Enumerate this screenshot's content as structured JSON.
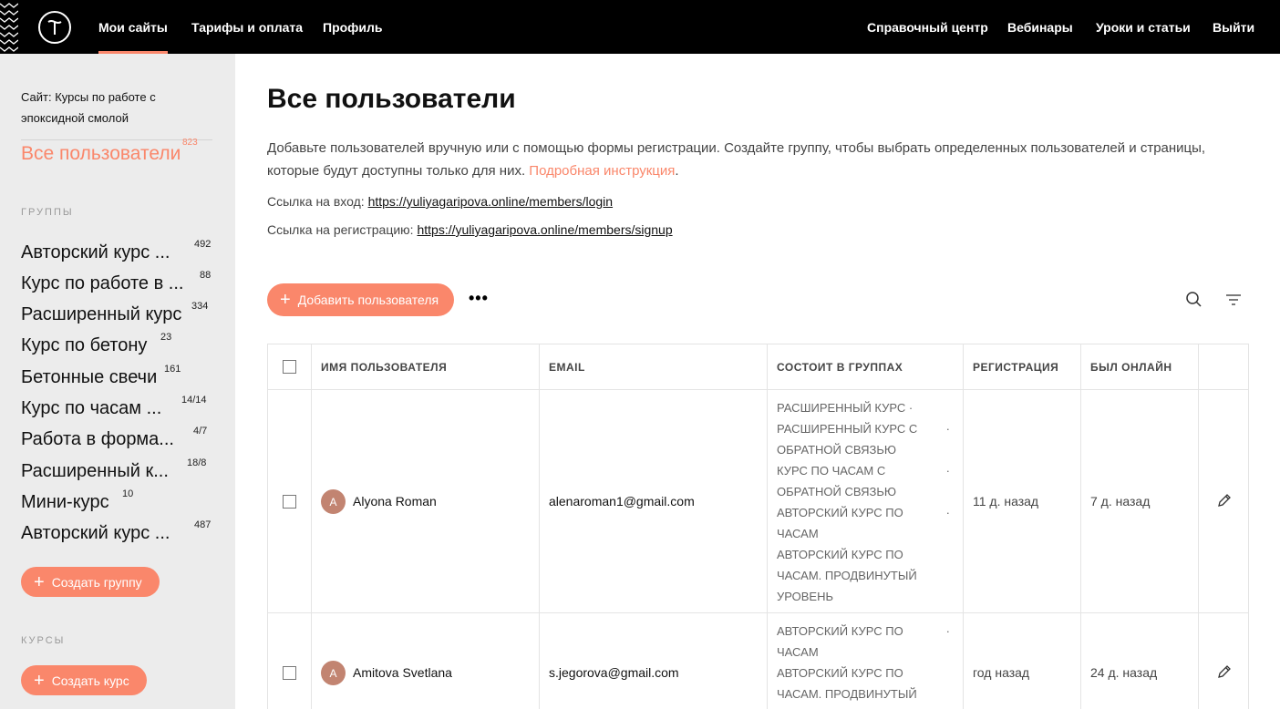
{
  "nav": {
    "left": [
      "Мои сайты",
      "Тарифы и оплата",
      "Профиль"
    ],
    "right": [
      "Справочный центр",
      "Вебинары",
      "Уроки и статьи",
      "Выйти"
    ]
  },
  "sidebar": {
    "site_label": "Сайт: Курсы по работе с эпоксидной смолой",
    "all_users_label": "Все пользователи",
    "all_users_count": "823",
    "groups_title": "ГРУППЫ",
    "groups": [
      {
        "name": "Авторский курс ...",
        "count": "492"
      },
      {
        "name": "Курс по работе в ...",
        "count": "88"
      },
      {
        "name": "Расширенный курс",
        "count": "334"
      },
      {
        "name": "Курс по бетону",
        "count": "23"
      },
      {
        "name": "Бетонные свечи",
        "count": "161"
      },
      {
        "name": "Курс по часам ...",
        "count": "14/14"
      },
      {
        "name": "Работа в форма...",
        "count": "4/7"
      },
      {
        "name": "Расширенный к...",
        "count": "18/8"
      },
      {
        "name": "Мини-курс",
        "count": "10"
      },
      {
        "name": "Авторский курс ...",
        "count": "487"
      }
    ],
    "create_group_label": "Создать группу",
    "courses_title": "КУРСЫ",
    "create_course_label": "Создать курс"
  },
  "main": {
    "title": "Все пользователи",
    "description": "Добавьте пользователей вручную или с помощью формы регистрации. Создайте группу, чтобы выбрать определенных пользователей и страницы, которые будут доступны только для них.",
    "instruction_link": "Подробная инструкция",
    "login_label": "Ссылка на вход:",
    "login_url": "https://yuliyagaripova.online/members/login",
    "signup_label": "Ссылка на регистрацию:",
    "signup_url": "https://yuliyagaripova.online/members/signup",
    "add_user_label": "Добавить пользователя",
    "more_label": "•••"
  },
  "table": {
    "headers": {
      "name": "ИМЯ ПОЛЬЗОВАТЕЛЯ",
      "email": "EMAIL",
      "groups": "СОСТОИТ В ГРУППАХ",
      "registered": "РЕГИСТРАЦИЯ",
      "online": "БЫЛ ОНЛАЙН"
    },
    "rows": [
      {
        "initial": "A",
        "name": "Alyona Roman",
        "email": "alenaroman1@gmail.com",
        "groups": [
          "РАСШИРЕННЫЙ КУРС",
          "РАСШИРЕННЫЙ КУРС С ОБРАТНОЙ СВЯЗЬЮ",
          "КУРС ПО ЧАСАМ С ОБРАТНОЙ СВЯЗЬЮ",
          "АВТОРСКИЙ КУРС ПО ЧАСАМ",
          "АВТОРСКИЙ КУРС ПО ЧАСАМ. ПРОДВИНУТЫЙ УРОВЕНЬ"
        ],
        "registered": "11 д. назад",
        "online": "7 д. назад"
      },
      {
        "initial": "A",
        "name": "Amitova Svetlana",
        "email": "s.jegorova@gmail.com",
        "groups": [
          "АВТОРСКИЙ КУРС ПО ЧАСАМ",
          "АВТОРСКИЙ КУРС ПО ЧАСАМ. ПРОДВИНУТЫЙ"
        ],
        "registered": "год назад",
        "online": "24 д. назад"
      }
    ]
  },
  "colors": {
    "accent": "#fa876b",
    "topbar": "#000000",
    "sidebar": "#ececec",
    "avatar": "#c28471"
  }
}
